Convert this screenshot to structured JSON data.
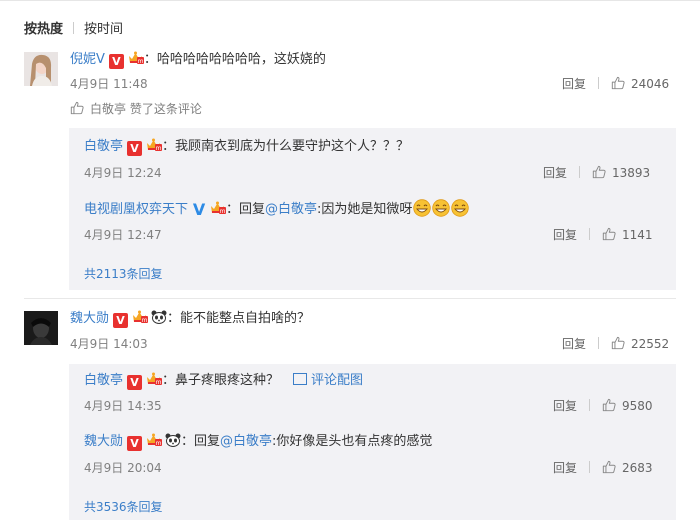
{
  "sort": {
    "by_hot": "按热度",
    "by_time": "按时间"
  },
  "comments": [
    {
      "user": "倪妮V",
      "text": "：哈哈哈哈哈哈哈哈，这妖娆的",
      "time": "4月9日 11:48",
      "reply_label": "回复",
      "likes": "24046",
      "liked_by": "白敬亭 赞了这条评论",
      "replies": [
        {
          "user": "白敬亭",
          "text": "：我顾南衣到底为什么要守护这个人？？？",
          "time": "4月9日 12:24",
          "reply_label": "回复",
          "likes": "13893"
        },
        {
          "user": "电视剧凰权弈天下",
          "prefix": "：回复",
          "mention": "@白敬亭",
          "text": ":因为她是知微呀",
          "time": "4月9日 12:47",
          "reply_label": "回复",
          "likes": "1141"
        }
      ],
      "more": "共2113条回复"
    },
    {
      "user": "魏大勋",
      "text": "：能不能整点自拍啥的？",
      "time": "4月9日 14:03",
      "reply_label": "回复",
      "likes": "22552",
      "replies": [
        {
          "user": "白敬亭",
          "text": "：鼻子疼眼疼这种？",
          "extra": "评论配图",
          "time": "4月9日 14:35",
          "reply_label": "回复",
          "likes": "9580"
        },
        {
          "user": "魏大勋",
          "prefix": "：回复",
          "mention": "@白敬亭",
          "text": ":你好像是头也有点疼的感觉",
          "time": "4月9日 20:04",
          "reply_label": "回复",
          "likes": "2683"
        }
      ],
      "more": "共3536条回复"
    }
  ],
  "colors": {
    "link": "#3b7ec8",
    "muted": "#808080",
    "reply_bg": "#f2f2f5",
    "v_badge": "#e8312f"
  },
  "icons": {
    "thumb": "thumbs-up-icon",
    "verified": "verified-v-icon",
    "level": "member-crown-icon",
    "panda": "panda-icon",
    "image": "image-icon",
    "emoji": "grin-emoji-icon"
  }
}
